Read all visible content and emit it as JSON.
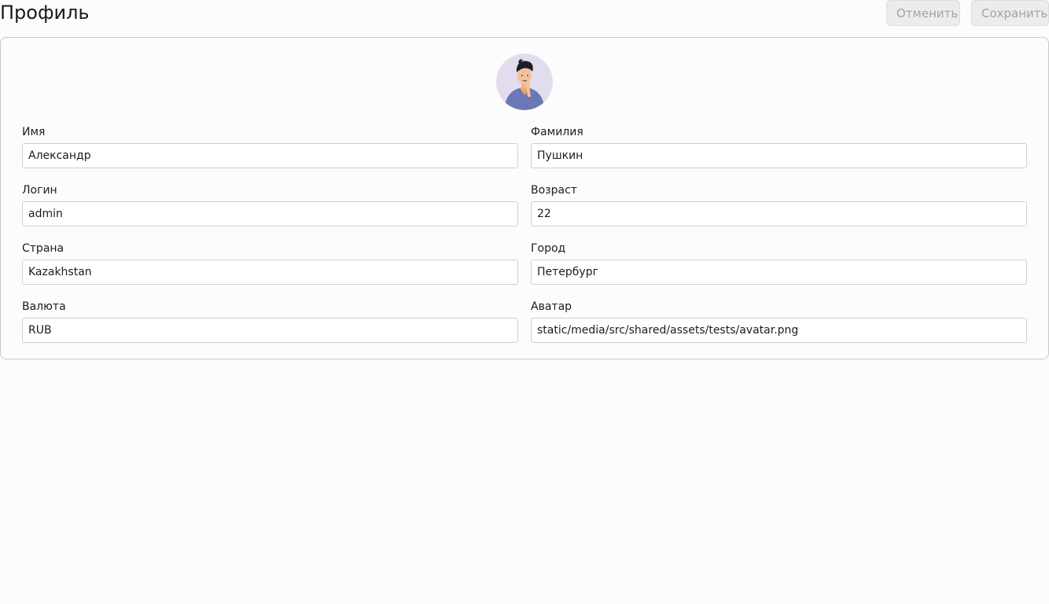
{
  "header": {
    "title": "Профиль",
    "cancel_label": "Отменить",
    "save_label": "Сохранить"
  },
  "profile": {
    "avatar_icon": "user-avatar",
    "fields": {
      "first_name": {
        "label": "Имя",
        "value": "Александр"
      },
      "last_name": {
        "label": "Фамилия",
        "value": "Пушкин"
      },
      "username": {
        "label": "Логин",
        "value": "admin"
      },
      "age": {
        "label": "Возраст",
        "value": "22"
      },
      "country": {
        "label": "Страна",
        "value": "Kazakhstan"
      },
      "city": {
        "label": "Город",
        "value": "Петербург"
      },
      "currency": {
        "label": "Валюта",
        "value": "RUB"
      },
      "avatar": {
        "label": "Аватар",
        "value": "static/media/src/shared/assets/tests/avatar.png"
      }
    }
  },
  "colors": {
    "background": "#fcfcfc",
    "avatar_bg": "#e3dcef",
    "shirt": "#6a78b5",
    "disabled_button_bg": "#ececec",
    "disabled_button_text": "#a3a3a3"
  }
}
